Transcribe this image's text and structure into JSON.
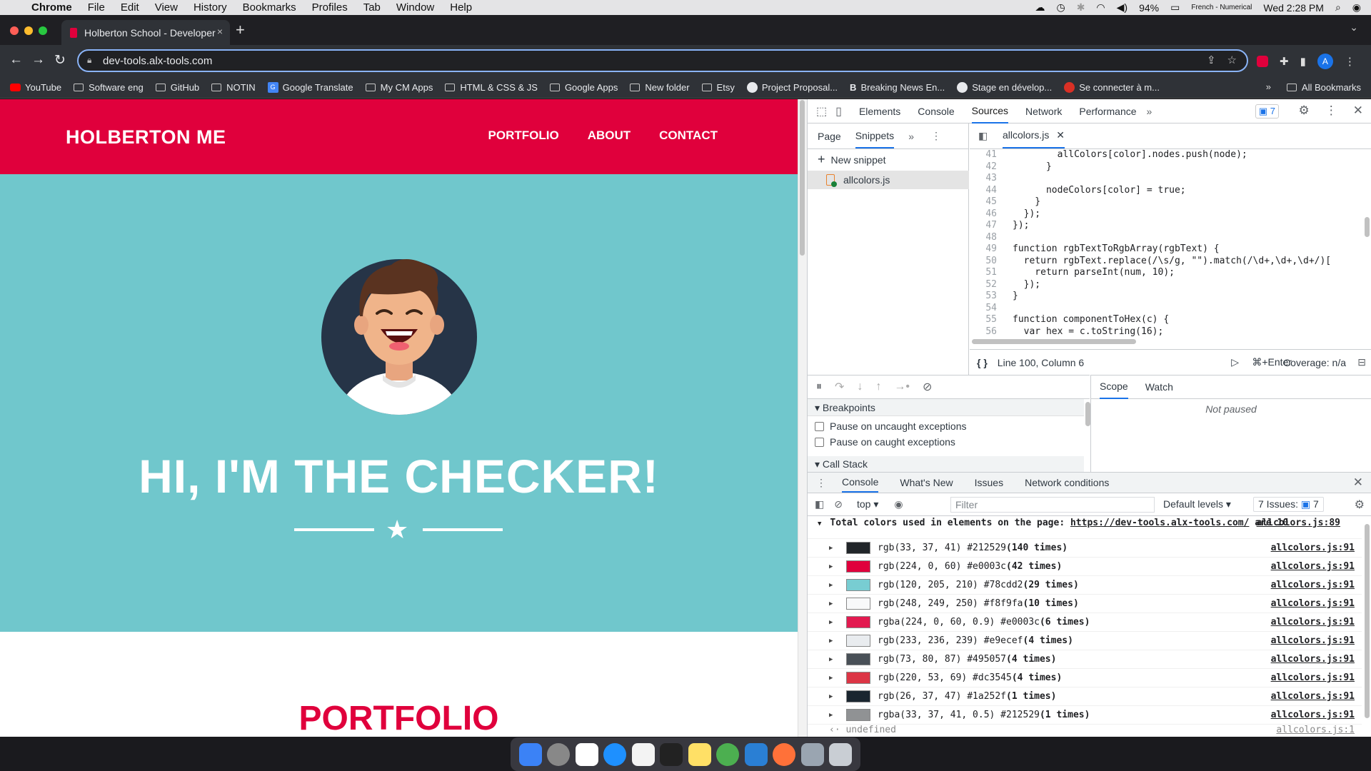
{
  "menubar": {
    "app": "Chrome",
    "items": [
      "File",
      "Edit",
      "View",
      "History",
      "Bookmarks",
      "Profiles",
      "Tab",
      "Window",
      "Help"
    ],
    "battery": "94%",
    "input_source": "French - Numerical",
    "clock": "Wed 2:28 PM"
  },
  "tab": {
    "title": "Holberton School - Developer",
    "close": "×",
    "new": "+"
  },
  "omnibox": {
    "url": "dev-tools.alx-tools.com"
  },
  "profile": {
    "initial": "A"
  },
  "bookmarks": {
    "items": [
      {
        "label": "YouTube",
        "icon": "youtube-icon"
      },
      {
        "label": "Software eng",
        "icon": "folder-icon"
      },
      {
        "label": "GitHub",
        "icon": "folder-icon"
      },
      {
        "label": "NOTIN",
        "icon": "folder-icon"
      },
      {
        "label": "Google Translate",
        "icon": "google-translate-icon"
      },
      {
        "label": "My CM Apps",
        "icon": "folder-icon"
      },
      {
        "label": "HTML & CSS & JS",
        "icon": "folder-icon"
      },
      {
        "label": "Google Apps",
        "icon": "folder-icon"
      },
      {
        "label": "New folder",
        "icon": "folder-icon"
      },
      {
        "label": "Etsy",
        "icon": "folder-icon"
      },
      {
        "label": "Project Proposal...",
        "icon": "openai-icon"
      },
      {
        "label": "Breaking News En...",
        "icon": "b-icon"
      },
      {
        "label": "Stage en dévelop...",
        "icon": "info-icon"
      },
      {
        "label": "Se connecter à m...",
        "icon": "avatar-icon"
      }
    ],
    "more": "»",
    "all": "All Bookmarks"
  },
  "site": {
    "brand": "HOLBERTON ME",
    "nav": [
      "PORTFOLIO",
      "ABOUT",
      "CONTACT"
    ],
    "hero_title": "HI, I'M THE CHECKER!",
    "portfolio_title": "PORTFOLIO"
  },
  "devtools": {
    "tabs": [
      "Elements",
      "Console",
      "Sources",
      "Network",
      "Performance"
    ],
    "active_tab": "Sources",
    "more": "»",
    "issues_count": "7",
    "navigator_tabs": [
      "Page",
      "Snippets"
    ],
    "new_snippet": "New snippet",
    "snippet_file": "allcolors.js",
    "editor_tab": "allcolors.js",
    "code_lines": [
      {
        "n": "41",
        "t": "        allColors[color].nodes.push(node);"
      },
      {
        "n": "42",
        "t": "      }"
      },
      {
        "n": "43",
        "t": ""
      },
      {
        "n": "44",
        "t": "      nodeColors[color] = true;"
      },
      {
        "n": "45",
        "t": "    }"
      },
      {
        "n": "46",
        "t": "  });"
      },
      {
        "n": "47",
        "t": "});"
      },
      {
        "n": "48",
        "t": ""
      },
      {
        "n": "49",
        "t": "function rgbTextToRgbArray(rgbText) {"
      },
      {
        "n": "50",
        "t": "  return rgbText.replace(/\\s/g, \"\").match(/\\d+,\\d+,\\d+/)["
      },
      {
        "n": "51",
        "t": "    return parseInt(num, 10);"
      },
      {
        "n": "52",
        "t": "  });"
      },
      {
        "n": "53",
        "t": "}"
      },
      {
        "n": "54",
        "t": ""
      },
      {
        "n": "55",
        "t": "function componentToHex(c) {"
      },
      {
        "n": "56",
        "t": "  var hex = c.toString(16);"
      }
    ],
    "status_position": "Line 100, Column 6",
    "run_shortcut": "⌘+Enter",
    "coverage": "Coverage: n/a",
    "scope_tabs": [
      "Scope",
      "Watch"
    ],
    "not_paused": "Not paused",
    "breakpoints": "Breakpoints",
    "pause_uncaught": "Pause on uncaught exceptions",
    "pause_caught": "Pause on caught exceptions",
    "call_stack": "Call Stack",
    "drawer_tabs": [
      "Console",
      "What's New",
      "Issues",
      "Network conditions"
    ],
    "context": "top",
    "filter_placeholder": "Filter",
    "levels": "Default levels",
    "issues_label": "7 Issues:",
    "console_header": {
      "prefix": "Total colors used in elements on the page: ",
      "link": "https://dev-tools.alx-tools.com/",
      "suffix": " are 10",
      "source": "allcolors.js:89"
    },
    "console_rows": [
      {
        "text": "rgb(33, 37, 41) #212529",
        "count": "(140 times)",
        "color": "#212529",
        "source": "allcolors.js:91"
      },
      {
        "text": "rgb(224, 0, 60) #e0003c",
        "count": "(42 times)",
        "color": "#e0003c",
        "source": "allcolors.js:91"
      },
      {
        "text": "rgb(120, 205, 210) #78cdd2",
        "count": "(29 times)",
        "color": "#78cdd2",
        "source": "allcolors.js:91"
      },
      {
        "text": "rgb(248, 249, 250) #f8f9fa",
        "count": "(10 times)",
        "color": "#f8f9fa",
        "source": "allcolors.js:91"
      },
      {
        "text": "rgba(224, 0, 60, 0.9) #e0003c",
        "count": "(6 times)",
        "color": "#e31a50",
        "source": "allcolors.js:91"
      },
      {
        "text": "rgb(233, 236, 239) #e9ecef",
        "count": "(4 times)",
        "color": "#e9ecef",
        "source": "allcolors.js:91"
      },
      {
        "text": "rgb(73, 80, 87) #495057",
        "count": "(4 times)",
        "color": "#495057",
        "source": "allcolors.js:91"
      },
      {
        "text": "rgb(220, 53, 69) #dc3545",
        "count": "(4 times)",
        "color": "#dc3545",
        "source": "allcolors.js:91"
      },
      {
        "text": "rgb(26, 37, 47) #1a252f",
        "count": "(1 times)",
        "color": "#1a252f",
        "source": "allcolors.js:91"
      },
      {
        "text": "rgba(33, 37, 41, 0.5) #212529",
        "count": "(1 times)",
        "color": "#909294",
        "source": "allcolors.js:91"
      }
    ],
    "undefined_line": {
      "text": "undefined",
      "source": "allcolors.js:1"
    }
  },
  "colors": {
    "accent": "#e0003c",
    "hero": "#70c7cc",
    "devtools_blue": "#1a73e8"
  }
}
